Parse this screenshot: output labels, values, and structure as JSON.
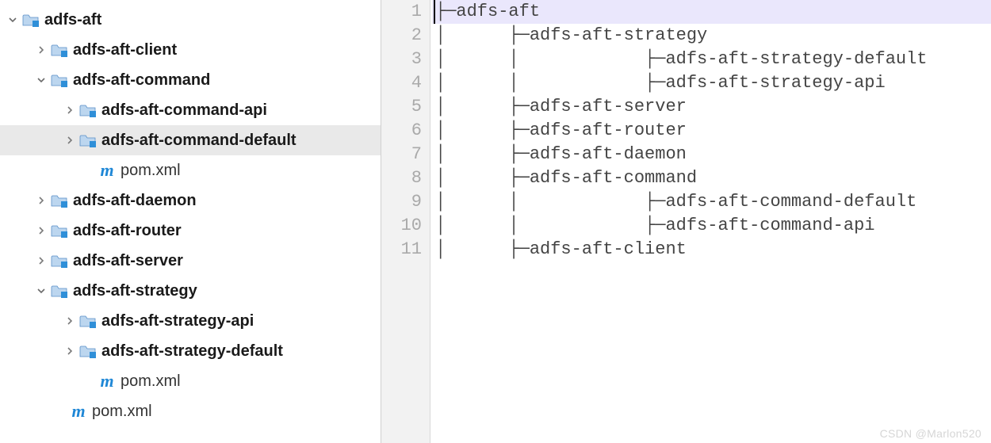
{
  "tree": {
    "rows": [
      {
        "indent": 4,
        "arrow": "down",
        "icon": "folder",
        "label": "adfs-aft",
        "bold": true,
        "selected": false
      },
      {
        "indent": 40,
        "arrow": "right",
        "icon": "folder",
        "label": "adfs-aft-client",
        "bold": true,
        "selected": false
      },
      {
        "indent": 40,
        "arrow": "down",
        "icon": "folder",
        "label": "adfs-aft-command",
        "bold": true,
        "selected": false
      },
      {
        "indent": 76,
        "arrow": "right",
        "icon": "folder",
        "label": "adfs-aft-command-api",
        "bold": true,
        "selected": false
      },
      {
        "indent": 76,
        "arrow": "right",
        "icon": "folder",
        "label": "adfs-aft-command-default",
        "bold": true,
        "selected": true
      },
      {
        "indent": 100,
        "arrow": "none",
        "icon": "m",
        "label": "pom.xml",
        "bold": false,
        "selected": false
      },
      {
        "indent": 40,
        "arrow": "right",
        "icon": "folder",
        "label": "adfs-aft-daemon",
        "bold": true,
        "selected": false
      },
      {
        "indent": 40,
        "arrow": "right",
        "icon": "folder",
        "label": "adfs-aft-router",
        "bold": true,
        "selected": false
      },
      {
        "indent": 40,
        "arrow": "right",
        "icon": "folder",
        "label": "adfs-aft-server",
        "bold": true,
        "selected": false
      },
      {
        "indent": 40,
        "arrow": "down",
        "icon": "folder",
        "label": "adfs-aft-strategy",
        "bold": true,
        "selected": false
      },
      {
        "indent": 76,
        "arrow": "right",
        "icon": "folder",
        "label": "adfs-aft-strategy-api",
        "bold": true,
        "selected": false
      },
      {
        "indent": 76,
        "arrow": "right",
        "icon": "folder",
        "label": "adfs-aft-strategy-default",
        "bold": true,
        "selected": false
      },
      {
        "indent": 100,
        "arrow": "none",
        "icon": "m",
        "label": "pom.xml",
        "bold": false,
        "selected": false
      },
      {
        "indent": 64,
        "arrow": "none",
        "icon": "m",
        "label": "pom.xml",
        "bold": false,
        "selected": false
      }
    ]
  },
  "editor": {
    "lines": [
      "├─adfs-aft",
      "│      ├─adfs-aft-strategy",
      "│      │            ├─adfs-aft-strategy-default",
      "│      │            ├─adfs-aft-strategy-api",
      "│      ├─adfs-aft-server",
      "│      ├─adfs-aft-router",
      "│      ├─adfs-aft-daemon",
      "│      ├─adfs-aft-command",
      "│      │            ├─adfs-aft-command-default",
      "│      │            ├─adfs-aft-command-api",
      "│      ├─adfs-aft-client"
    ],
    "highlight": 0
  },
  "watermark": "CSDN @Marlon520"
}
